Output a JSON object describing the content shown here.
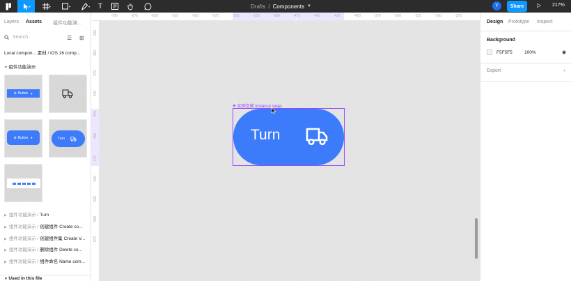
{
  "toolbar": {
    "breadcrumb_project": "Drafts",
    "breadcrumb_sep": "/",
    "file_name": "Components",
    "avatar_initial": "Y",
    "share_label": "Share",
    "zoom": "217%",
    "active_color": "#0d99ff"
  },
  "left_panel": {
    "tabs": [
      "Layers",
      "Assets",
      "组件功能演..."
    ],
    "search_placeholder": "Search",
    "library_path": "Local compon... 素材 / iOS 16 comp...",
    "group_title": "组件功能演示",
    "thumbnails": [
      {
        "label": "Button"
      },
      {
        "icon": "truck-icon"
      },
      {
        "label": "Button"
      },
      {
        "label": "Turn"
      },
      {
        "icon": "dots-pattern"
      }
    ],
    "list_items": [
      {
        "muted": "组件功能演示 / ",
        "name": "Turn"
      },
      {
        "muted": "组件功能演示 / ",
        "name": "创建组件 Create co..."
      },
      {
        "muted": "组件功能演示 / ",
        "name": "创建组件集 Create V..."
      },
      {
        "muted": "组件功能演示 / ",
        "name": "删除组件 Delete co..."
      },
      {
        "muted": "组件功能演示 / ",
        "name": "组件命名 Name com..."
      }
    ],
    "used_in_file": "Used in this file"
  },
  "ruler": {
    "top_ticks": [
      "-700",
      "-675",
      "-650",
      "-625",
      "-600",
      "-575",
      "-550",
      "-525",
      "-500",
      "-475",
      "-450",
      "-425",
      "-400",
      "-375",
      "-350",
      "-325",
      "-300",
      "-275"
    ],
    "left_ticks": [
      "325",
      "350",
      "375",
      "400",
      "425",
      "450",
      "475",
      "500",
      "525",
      "550",
      "575"
    ]
  },
  "canvas": {
    "instance_label": "实例交换 Instance swap",
    "button_label": "Turn",
    "button_color": "#3c7bfa",
    "selection_color": "#9747ff"
  },
  "right_panel": {
    "tabs": [
      "Design",
      "Prototype",
      "Inspect"
    ],
    "background_title": "Background",
    "background_hex": "F5F5F5",
    "background_opacity": "100%",
    "export_title": "Export"
  }
}
